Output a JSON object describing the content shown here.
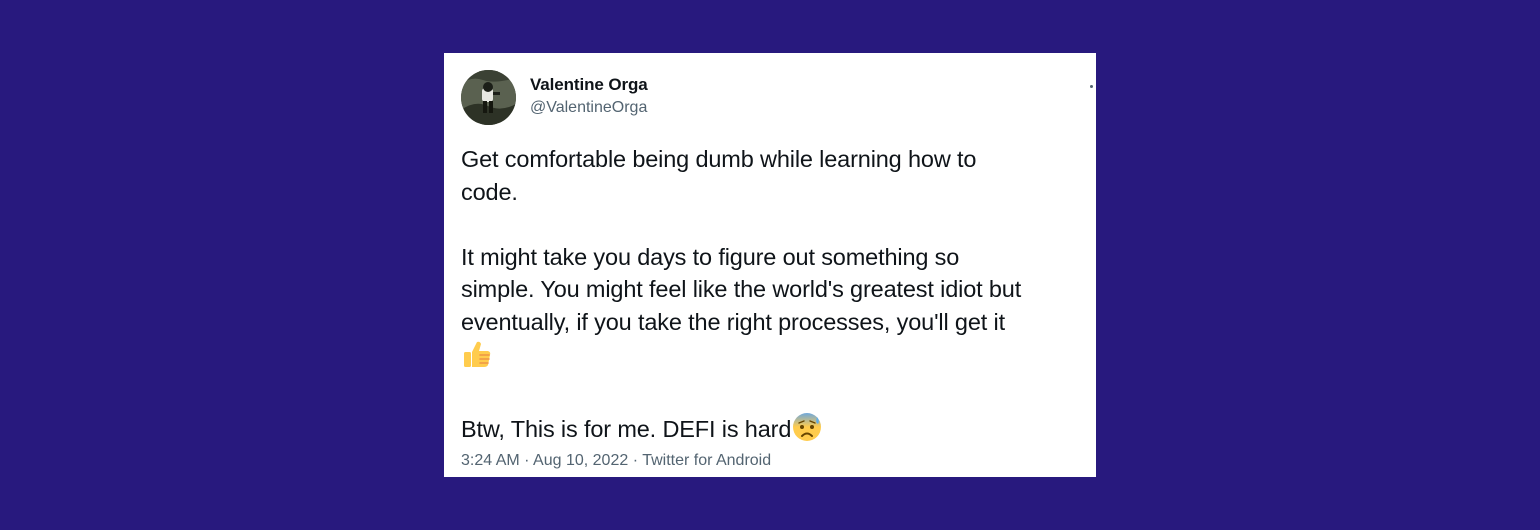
{
  "tweet": {
    "author": {
      "name": "Valentine Orga",
      "handle": "@ValentineOrga"
    },
    "text_lines": [
      "Get comfortable being dumb while learning how to",
      "code.",
      "It might take you days to figure out something so",
      "simple. You might feel like the world's greatest idiot but",
      "eventually, if you take the right processes, you'll get it",
      "Btw, This is for me. DEFI is hard"
    ],
    "emojis": {
      "thumbs_up": "thumbs-up-icon",
      "anxious_face": "anxious-face-with-sweat-icon"
    },
    "meta": {
      "time": "3:24 AM",
      "separator": "·",
      "date": "Aug 10, 2022",
      "source": "Twitter for Android"
    }
  },
  "colors": {
    "background": "#28197e",
    "card": "#ffffff",
    "text": "#0f1419",
    "secondary_text": "#536471"
  }
}
